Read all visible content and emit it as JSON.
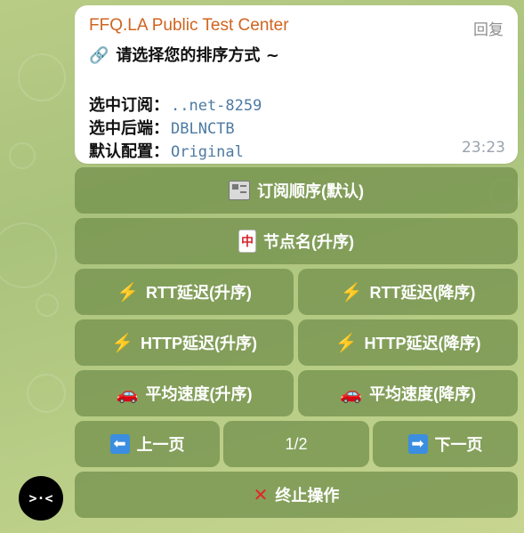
{
  "message": {
    "sender": "FFQ.LA Public Test Center",
    "reply_label": "回复",
    "prompt_icon": "🔗",
    "prompt": "请选择您的排序方式 ~",
    "rows": [
      {
        "label": "选中订阅：",
        "value": "..net-8259"
      },
      {
        "label": "选中后端：",
        "value": "DBLNCTB"
      },
      {
        "label": "默认配置：",
        "value": "Original"
      }
    ],
    "time": "23:23"
  },
  "keyboard": {
    "sub_order": "订阅顺序(默认)",
    "node_name": "节点名(升序)",
    "rtt_asc": "RTT延迟(升序)",
    "rtt_desc": "RTT延迟(降序)",
    "http_asc": "HTTP延迟(升序)",
    "http_desc": "HTTP延迟(降序)",
    "speed_asc": "平均速度(升序)",
    "speed_desc": "平均速度(降序)",
    "prev": "上一页",
    "page": "1/2",
    "next": "下一页",
    "abort": "终止操作"
  },
  "icons": {
    "bolt": "⚡",
    "car": "🚗",
    "left_arrow": "⬅",
    "right_arrow": "➡",
    "cross": "✕",
    "mahjong": "中"
  },
  "avatar": {
    "text": ">·<"
  },
  "colors": {
    "sender": "#d0641e",
    "value": "#4d7aa3",
    "button_bg": "#74924e"
  }
}
